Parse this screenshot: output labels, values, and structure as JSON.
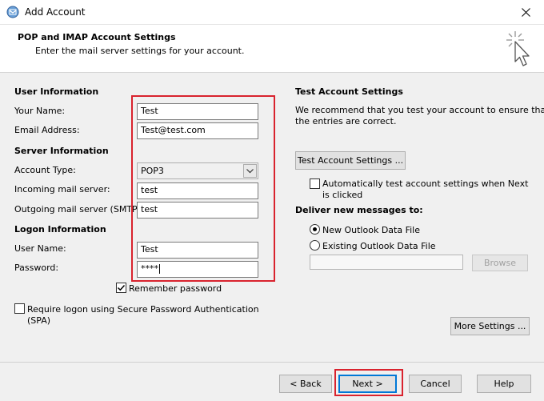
{
  "window": {
    "title": "Add Account"
  },
  "header": {
    "title": "POP and IMAP Account Settings",
    "subtitle": "Enter the mail server settings for your account."
  },
  "user_info": {
    "section": "User Information",
    "name_label": "Your Name:",
    "name_value": "Test",
    "email_label": "Email Address:",
    "email_value": "Test@test.com"
  },
  "server_info": {
    "section": "Server Information",
    "account_type_label": "Account Type:",
    "account_type_value": "POP3",
    "incoming_label": "Incoming mail server:",
    "incoming_value": "test",
    "outgoing_label": "Outgoing mail server (SMTP):",
    "outgoing_value": "test"
  },
  "logon_info": {
    "section": "Logon Information",
    "username_label": "User Name:",
    "username_value": "Test",
    "password_label": "Password:",
    "password_value": "****",
    "remember_label": "Remember password",
    "remember_checked": true,
    "spa_label_line1": "Require logon using Secure Password Authentication",
    "spa_label_line2": "(SPA)",
    "spa_checked": false
  },
  "test_settings": {
    "section": "Test Account Settings",
    "description_line1": "We recommend that you test your account to ensure that",
    "description_line2": "the entries are correct.",
    "test_button": "Test Account Settings ...",
    "auto_test_line1": "Automatically test account settings when Next",
    "auto_test_line2": "is clicked",
    "auto_test_checked": false
  },
  "deliver": {
    "section": "Deliver new messages to:",
    "new_file": "New Outlook Data File",
    "existing_file": "Existing Outlook Data File",
    "selected": "new",
    "path_value": "",
    "browse_button": "Browse"
  },
  "more_settings_button": "More Settings ...",
  "footer": {
    "back": "< Back",
    "next": "Next >",
    "cancel": "Cancel",
    "help": "Help"
  },
  "colors": {
    "highlight": "#d9232e",
    "focus": "#0078d7",
    "background": "#f0f0f0"
  }
}
